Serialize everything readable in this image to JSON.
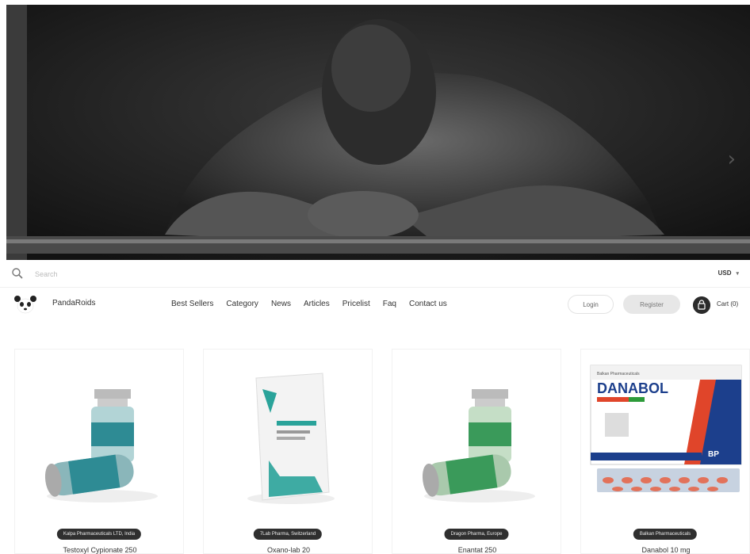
{
  "search": {
    "placeholder": "Search"
  },
  "currency": {
    "value": "USD",
    "caret": "▾"
  },
  "brand": {
    "name": "PandaRoids"
  },
  "nav": {
    "links": [
      "Best Sellers",
      "Category",
      "News",
      "Articles",
      "Pricelist",
      "Faq",
      "Contact us"
    ]
  },
  "auth": {
    "login": "Login",
    "register": "Register"
  },
  "cart": {
    "label": "Cart (0)"
  },
  "hero": {
    "next_arrow": "›"
  },
  "products": [
    {
      "manufacturer": "Kalpa Pharmaceuticals LTD, India",
      "name": "Testoxyl Cypionate 250",
      "accent": "#2e8b94"
    },
    {
      "manufacturer": "7Lab Pharma, Switzerland",
      "name": "Oxano-lab 20",
      "accent": "#2aa39a"
    },
    {
      "manufacturer": "Dragon Pharma, Europe",
      "name": "Enantat 250",
      "accent": "#3a9a5a"
    },
    {
      "manufacturer": "Balkan Pharmaceuticals",
      "name": "Danabol 10 mg",
      "accent": "#e0452a"
    }
  ],
  "danabol_box": {
    "title": "DANABOL",
    "maker": "Balkan Pharmaceuticals",
    "logo": "BP"
  }
}
